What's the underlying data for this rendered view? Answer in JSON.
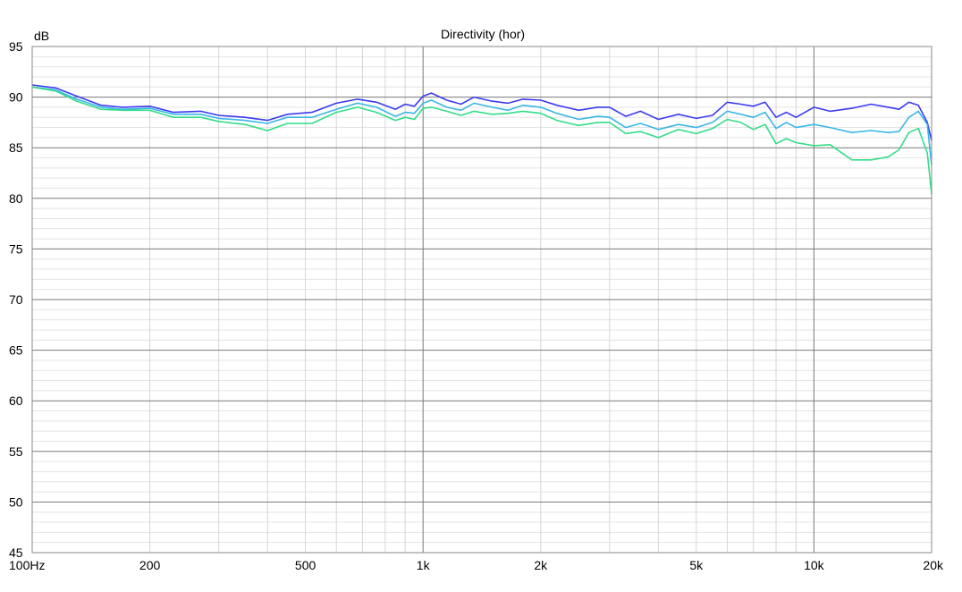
{
  "chart_data": {
    "type": "line",
    "title": "Directivity (hor)",
    "ylabel": "dB",
    "xlabel": "",
    "x_scale": "log",
    "xlim": [
      100,
      20000
    ],
    "ylim": [
      45,
      95
    ],
    "grid": true,
    "x_tick_labels": [
      {
        "value": 100,
        "label": "100Hz"
      },
      {
        "value": 200,
        "label": "200"
      },
      {
        "value": 500,
        "label": "500"
      },
      {
        "value": 1000,
        "label": "1k"
      },
      {
        "value": 2000,
        "label": "2k"
      },
      {
        "value": 5000,
        "label": "5k"
      },
      {
        "value": 10000,
        "label": "10k"
      },
      {
        "value": 20000,
        "label": "20k"
      }
    ],
    "y_ticks": [
      45,
      50,
      55,
      60,
      65,
      70,
      75,
      80,
      85,
      90,
      95
    ],
    "series": [
      {
        "color": "#3b3bf0",
        "points": [
          [
            100,
            91.2
          ],
          [
            115,
            90.9
          ],
          [
            130,
            90.1
          ],
          [
            150,
            89.2
          ],
          [
            170,
            89.0
          ],
          [
            200,
            89.1
          ],
          [
            230,
            88.5
          ],
          [
            270,
            88.6
          ],
          [
            300,
            88.2
          ],
          [
            350,
            88.0
          ],
          [
            400,
            87.7
          ],
          [
            450,
            88.3
          ],
          [
            520,
            88.5
          ],
          [
            600,
            89.4
          ],
          [
            680,
            89.8
          ],
          [
            760,
            89.5
          ],
          [
            850,
            88.8
          ],
          [
            900,
            89.3
          ],
          [
            950,
            89.1
          ],
          [
            1000,
            90.1
          ],
          [
            1050,
            90.4
          ],
          [
            1150,
            89.7
          ],
          [
            1250,
            89.3
          ],
          [
            1350,
            90.0
          ],
          [
            1500,
            89.6
          ],
          [
            1650,
            89.4
          ],
          [
            1800,
            89.8
          ],
          [
            2000,
            89.7
          ],
          [
            2200,
            89.2
          ],
          [
            2500,
            88.7
          ],
          [
            2800,
            89.0
          ],
          [
            3000,
            89.0
          ],
          [
            3300,
            88.1
          ],
          [
            3600,
            88.6
          ],
          [
            4000,
            87.8
          ],
          [
            4500,
            88.3
          ],
          [
            5000,
            87.9
          ],
          [
            5500,
            88.2
          ],
          [
            6000,
            89.5
          ],
          [
            6500,
            89.3
          ],
          [
            7000,
            89.1
          ],
          [
            7500,
            89.5
          ],
          [
            8000,
            88.0
          ],
          [
            8500,
            88.5
          ],
          [
            9000,
            88.0
          ],
          [
            10000,
            89.0
          ],
          [
            11000,
            88.6
          ],
          [
            12500,
            88.9
          ],
          [
            14000,
            89.3
          ],
          [
            15500,
            89.0
          ],
          [
            16500,
            88.8
          ],
          [
            17500,
            89.5
          ],
          [
            18500,
            89.2
          ],
          [
            19500,
            87.5
          ],
          [
            20000,
            85.7
          ]
        ]
      },
      {
        "color": "#3ab6e6",
        "points": [
          [
            100,
            91.0
          ],
          [
            115,
            90.7
          ],
          [
            130,
            89.8
          ],
          [
            150,
            89.0
          ],
          [
            170,
            88.8
          ],
          [
            200,
            88.9
          ],
          [
            230,
            88.3
          ],
          [
            270,
            88.3
          ],
          [
            300,
            87.9
          ],
          [
            350,
            87.7
          ],
          [
            400,
            87.4
          ],
          [
            450,
            88.0
          ],
          [
            520,
            88.0
          ],
          [
            600,
            88.8
          ],
          [
            680,
            89.4
          ],
          [
            760,
            89.0
          ],
          [
            850,
            88.1
          ],
          [
            900,
            88.5
          ],
          [
            950,
            88.4
          ],
          [
            1000,
            89.4
          ],
          [
            1050,
            89.7
          ],
          [
            1150,
            89.0
          ],
          [
            1250,
            88.7
          ],
          [
            1350,
            89.4
          ],
          [
            1500,
            89.0
          ],
          [
            1650,
            88.7
          ],
          [
            1800,
            89.2
          ],
          [
            2000,
            89.0
          ],
          [
            2200,
            88.4
          ],
          [
            2500,
            87.8
          ],
          [
            2800,
            88.1
          ],
          [
            3000,
            88.0
          ],
          [
            3300,
            87.0
          ],
          [
            3600,
            87.4
          ],
          [
            4000,
            86.8
          ],
          [
            4500,
            87.3
          ],
          [
            5000,
            87.0
          ],
          [
            5500,
            87.5
          ],
          [
            6000,
            88.6
          ],
          [
            6500,
            88.3
          ],
          [
            7000,
            88.0
          ],
          [
            7500,
            88.5
          ],
          [
            8000,
            86.9
          ],
          [
            8500,
            87.5
          ],
          [
            9000,
            87.0
          ],
          [
            10000,
            87.3
          ],
          [
            11000,
            87.0
          ],
          [
            12500,
            86.5
          ],
          [
            14000,
            86.7
          ],
          [
            15500,
            86.5
          ],
          [
            16500,
            86.6
          ],
          [
            17500,
            88.0
          ],
          [
            18500,
            88.6
          ],
          [
            19500,
            87.3
          ],
          [
            20000,
            83.3
          ]
        ]
      },
      {
        "color": "#33dd88",
        "points": [
          [
            100,
            91.0
          ],
          [
            115,
            90.6
          ],
          [
            130,
            89.6
          ],
          [
            150,
            88.8
          ],
          [
            170,
            88.7
          ],
          [
            200,
            88.7
          ],
          [
            230,
            88.0
          ],
          [
            270,
            88.0
          ],
          [
            300,
            87.6
          ],
          [
            350,
            87.3
          ],
          [
            400,
            86.7
          ],
          [
            450,
            87.4
          ],
          [
            520,
            87.4
          ],
          [
            600,
            88.5
          ],
          [
            680,
            89.0
          ],
          [
            760,
            88.5
          ],
          [
            850,
            87.7
          ],
          [
            900,
            88.0
          ],
          [
            950,
            87.8
          ],
          [
            1000,
            88.9
          ],
          [
            1050,
            89.0
          ],
          [
            1150,
            88.6
          ],
          [
            1250,
            88.2
          ],
          [
            1350,
            88.6
          ],
          [
            1500,
            88.3
          ],
          [
            1650,
            88.4
          ],
          [
            1800,
            88.6
          ],
          [
            2000,
            88.4
          ],
          [
            2200,
            87.7
          ],
          [
            2500,
            87.2
          ],
          [
            2800,
            87.5
          ],
          [
            3000,
            87.5
          ],
          [
            3300,
            86.4
          ],
          [
            3600,
            86.6
          ],
          [
            4000,
            86.0
          ],
          [
            4500,
            86.8
          ],
          [
            5000,
            86.4
          ],
          [
            5500,
            86.9
          ],
          [
            6000,
            87.8
          ],
          [
            6500,
            87.5
          ],
          [
            7000,
            86.8
          ],
          [
            7500,
            87.3
          ],
          [
            8000,
            85.4
          ],
          [
            8500,
            85.9
          ],
          [
            9000,
            85.5
          ],
          [
            10000,
            85.2
          ],
          [
            11000,
            85.3
          ],
          [
            12500,
            83.8
          ],
          [
            14000,
            83.8
          ],
          [
            15500,
            84.1
          ],
          [
            16500,
            84.8
          ],
          [
            17500,
            86.5
          ],
          [
            18500,
            86.9
          ],
          [
            19500,
            84.5
          ],
          [
            20000,
            80.4
          ]
        ]
      }
    ]
  }
}
